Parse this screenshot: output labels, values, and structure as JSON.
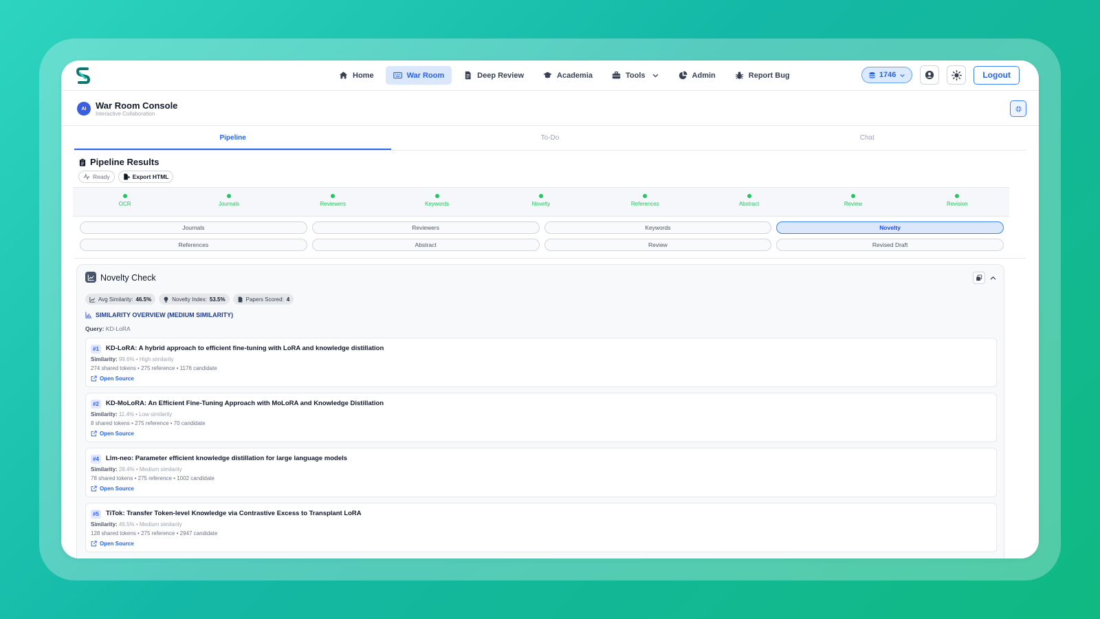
{
  "nav": {
    "items": [
      {
        "label": "Home",
        "icon": "home-icon"
      },
      {
        "label": "War Room",
        "icon": "keyboard-icon",
        "active": true
      },
      {
        "label": "Deep Review",
        "icon": "document-icon"
      },
      {
        "label": "Academia",
        "icon": "graduation-cap-icon"
      },
      {
        "label": "Tools",
        "icon": "toolbox-icon"
      },
      {
        "label": "Admin",
        "icon": "pie-chart-icon"
      },
      {
        "label": "Report Bug",
        "icon": "bug-icon"
      }
    ],
    "credits": "1746",
    "logout": "Logout"
  },
  "console": {
    "avatar": "AI",
    "title": "War Room Console",
    "subtitle": "Interactive Collaboration"
  },
  "tabs": [
    "Pipeline",
    "To-Do",
    "Chat"
  ],
  "pipeline": {
    "title": "Pipeline Results",
    "status": "Ready",
    "export": "Export HTML",
    "stages": [
      "OCR",
      "Journals",
      "Reviewers",
      "Keywords",
      "Novelty",
      "References",
      "Abstract",
      "Review",
      "Revision"
    ],
    "pills": [
      "Journals",
      "Reviewers",
      "Keywords",
      "Novelty",
      "References",
      "Abstract",
      "Review",
      "Revised Draft"
    ],
    "active_pill": "Novelty"
  },
  "novelty": {
    "title": "Novelty Check",
    "stats": [
      {
        "label": "Avg Similarity:",
        "value": "46.5%"
      },
      {
        "label": "Novelty Index:",
        "value": "53.5%"
      },
      {
        "label": "Papers Scored:",
        "value": "4"
      }
    ],
    "overview": "SIMILARITY OVERVIEW (MEDIUM SIMILARITY)",
    "query_label": "Query:",
    "query": "KD-LoRA",
    "results": [
      {
        "num": "#1",
        "title": "KD-LoRA: A hybrid approach to efficient fine-tuning with LoRA and knowledge distillation",
        "sim_label": "Similarity:",
        "sim": "99.6% • High similarity",
        "tokens": "274 shared tokens • 275 reference • 1176 candidate",
        "link": "Open Source"
      },
      {
        "num": "#2",
        "title": "KD-MoLoRA: An Efficient Fine-Tuning Approach with MoLoRA and Knowledge Distillation",
        "sim_label": "Similarity:",
        "sim": "11.4% • Low similarity",
        "tokens": "8 shared tokens • 275 reference • 70 candidate",
        "link": "Open Source"
      },
      {
        "num": "#4",
        "title": "Llm-neo: Parameter efficient knowledge distillation for large language models",
        "sim_label": "Similarity:",
        "sim": "28.4% • Medium similarity",
        "tokens": "78 shared tokens • 275 reference • 1002 candidate",
        "link": "Open Source"
      },
      {
        "num": "#5",
        "title": "TiTok: Transfer Token-level Knowledge via Contrastive Excess to Transplant LoRA",
        "sim_label": "Similarity:",
        "sim": "46.5% • Medium similarity",
        "tokens": "128 shared tokens • 275 reference • 2947 candidate",
        "link": "Open Source"
      }
    ]
  }
}
